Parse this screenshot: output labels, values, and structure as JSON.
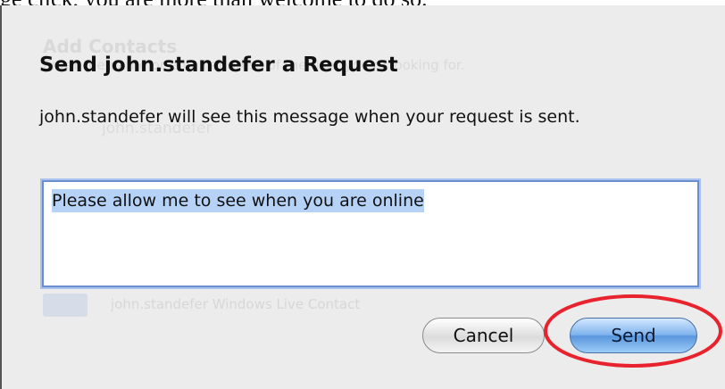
{
  "page": {
    "top_cut_text": "ge click, you are more than welcome to do so."
  },
  "background": {
    "title": "Add Contacts",
    "subtitle": "Enter the name or email address of the user you're looking for.",
    "contact_name": "john.standefer",
    "row_text": "john.standefer   Windows Live Contact"
  },
  "dialog": {
    "title": "Send john.standefer a Request",
    "message": "john.standefer will see this message when your request is sent.",
    "request_text": "Please allow me to see when you are online",
    "cancel_label": "Cancel",
    "send_label": "Send"
  },
  "annotation": {
    "color": "#e8232d",
    "target": "send-button"
  }
}
